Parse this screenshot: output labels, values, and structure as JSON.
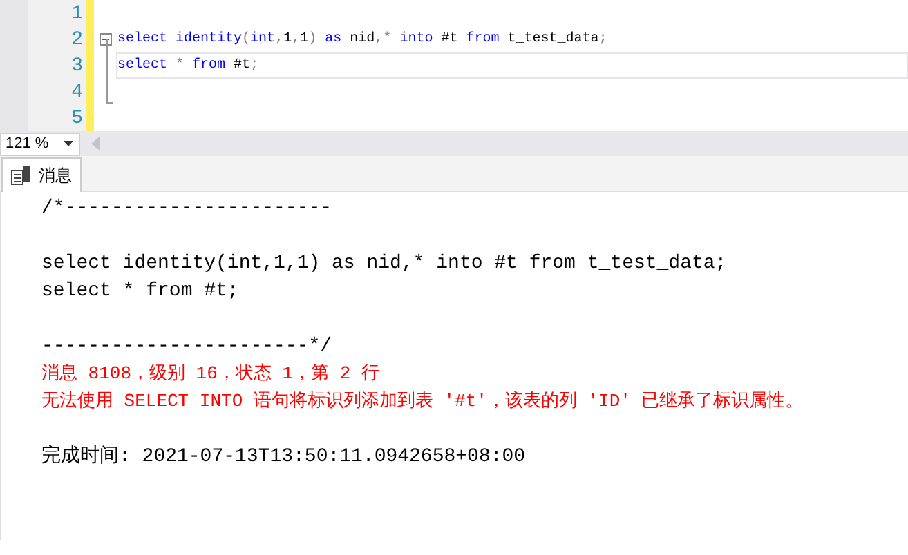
{
  "editor": {
    "lines": [
      {
        "number": "1"
      },
      {
        "number": "2",
        "fold": true,
        "tokens": [
          {
            "text": "select ",
            "kind": "kw"
          },
          {
            "text": "identity",
            "kind": "kw"
          },
          {
            "text": "(",
            "kind": "op"
          },
          {
            "text": "int",
            "kind": "kw"
          },
          {
            "text": ",",
            "kind": "op"
          },
          {
            "text": "1",
            "kind": "text"
          },
          {
            "text": ",",
            "kind": "op"
          },
          {
            "text": "1",
            "kind": "text"
          },
          {
            "text": ") ",
            "kind": "op"
          },
          {
            "text": "as",
            "kind": "kw"
          },
          {
            "text": " nid",
            "kind": "text"
          },
          {
            "text": ",* ",
            "kind": "op"
          },
          {
            "text": "into",
            "kind": "kw"
          },
          {
            "text": " #t ",
            "kind": "text"
          },
          {
            "text": "from",
            "kind": "kw"
          },
          {
            "text": " t_test_data",
            "kind": "text"
          },
          {
            "text": ";",
            "kind": "op"
          }
        ]
      },
      {
        "number": "3",
        "current": true,
        "tokens": [
          {
            "text": "select",
            "kind": "kw"
          },
          {
            "text": " * ",
            "kind": "op"
          },
          {
            "text": "from",
            "kind": "kw"
          },
          {
            "text": " #t",
            "kind": "text"
          },
          {
            "text": ";",
            "kind": "op"
          }
        ]
      },
      {
        "number": "4"
      },
      {
        "number": "5"
      }
    ]
  },
  "zoom": {
    "value": "121 %"
  },
  "tabs": [
    {
      "label": "消息",
      "selected": true
    }
  ],
  "message_blocks": [
    [
      {
        "text": "/*-----------------------",
        "kind": "normal"
      }
    ],
    [
      {
        "text": "select identity(int,1,1) as nid,* into #t from t_test_data;",
        "kind": "normal"
      },
      {
        "text": "select * from #t;",
        "kind": "normal"
      }
    ],
    [
      {
        "text": "-----------------------*/",
        "kind": "normal"
      },
      {
        "text": "消息 8108，级别 16，状态 1，第 2 行",
        "kind": "error"
      },
      {
        "text": "无法使用 SELECT INTO 语句将标识列添加到表 '#t'，该表的列 'ID' 已继承了标识属性。",
        "kind": "error"
      }
    ],
    [
      {
        "text": "完成时间: 2021-07-13T13:50:11.0942658+08:00",
        "kind": "normal"
      }
    ]
  ]
}
